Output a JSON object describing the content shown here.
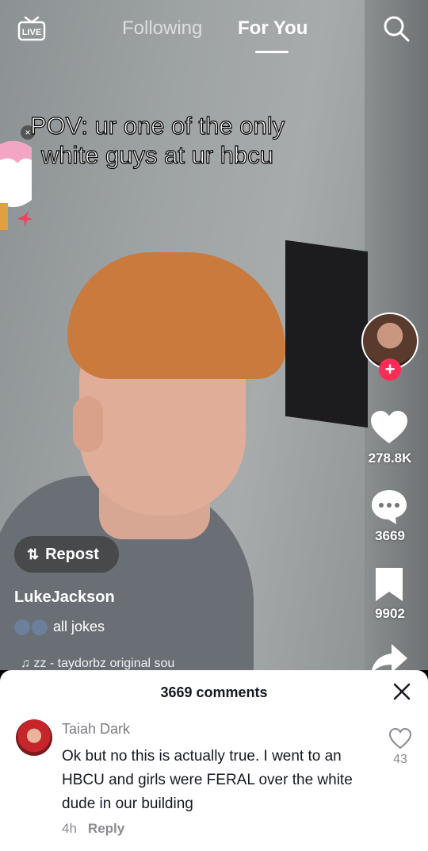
{
  "topbar": {
    "live_label": "LIVE",
    "tabs": [
      {
        "label": "Following",
        "active": false
      },
      {
        "label": "For You",
        "active": true
      }
    ],
    "search_icon": "search-icon"
  },
  "video": {
    "caption_line1": "POV: ur one of the only",
    "caption_line2": "white guys at ur hbcu"
  },
  "rail": {
    "like_count": "278.8K",
    "comment_count": "3669",
    "save_count": "9902"
  },
  "post": {
    "repost_label": "Repost",
    "username": "LukeJackson",
    "description": "all jokes",
    "music": "zz - taydorbz    original sou"
  },
  "comments": {
    "title": "3669 comments",
    "items": [
      {
        "author": "Taiah Dark",
        "text": "Ok but no this is actually true. I went to an HBCU and girls were FERAL over the white dude in our building",
        "time": "4h",
        "reply_label": "Reply",
        "likes": "43"
      }
    ]
  },
  "colors": {
    "accent": "#fe2c55",
    "text_dark": "#161823",
    "text_muted": "#8a8b91"
  }
}
